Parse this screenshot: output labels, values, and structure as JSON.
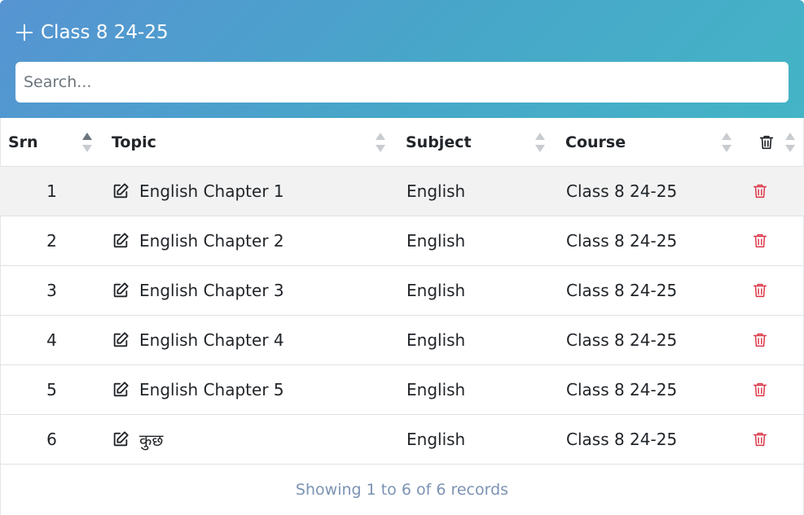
{
  "header": {
    "title": "Class 8 24-25",
    "add_icon": "plus-icon",
    "gradient_start": "#5694d2",
    "gradient_end": "#44b4c6"
  },
  "search": {
    "placeholder": "Search...",
    "value": ""
  },
  "table": {
    "columns": [
      {
        "label": "Srn",
        "sort": "ascending"
      },
      {
        "label": "Topic",
        "sort": "none"
      },
      {
        "label": "Subject",
        "sort": "none"
      },
      {
        "label": "Course",
        "sort": "none"
      },
      {
        "label": "",
        "icon": "trash-icon",
        "sort": "none"
      }
    ],
    "rows": [
      {
        "srn": "1",
        "topic": "English Chapter 1",
        "subject": "English",
        "course": "Class 8 24-25"
      },
      {
        "srn": "2",
        "topic": "English Chapter 2",
        "subject": "English",
        "course": "Class 8 24-25"
      },
      {
        "srn": "3",
        "topic": "English Chapter 3",
        "subject": "English",
        "course": "Class 8 24-25"
      },
      {
        "srn": "4",
        "topic": "English Chapter 4",
        "subject": "English",
        "course": "Class 8 24-25"
      },
      {
        "srn": "5",
        "topic": "English Chapter 5",
        "subject": "English",
        "course": "Class 8 24-25"
      },
      {
        "srn": "6",
        "topic": "कुछ",
        "subject": "English",
        "course": "Class 8 24-25"
      }
    ],
    "row_icons": {
      "edit": "edit-icon",
      "delete": "trash-icon"
    },
    "delete_color": "#dc3545",
    "course_color": "#868e96"
  },
  "footer": {
    "status": "Showing 1 to 6 of 6 records"
  }
}
